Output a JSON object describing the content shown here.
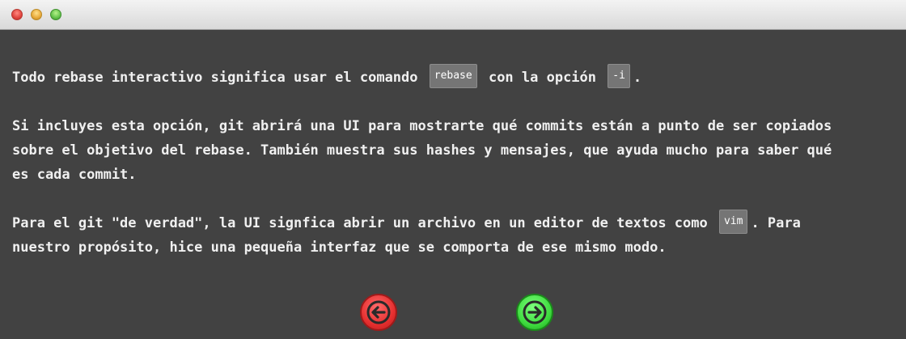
{
  "paragraphs": {
    "p1": {
      "before": "Todo rebase interactivo significa usar el comando ",
      "code1": "rebase",
      "middle": " con la opción ",
      "code2": "-i",
      "after": "."
    },
    "p2": {
      "line1": "Si incluyes esta opción, git abrirá una UI para mostrarte qué commits están a punto de ser copiados",
      "line2": "sobre el objetivo del rebase. También muestra sus hashes y mensajes, que ayuda mucho para saber qué",
      "line3": "es cada commit."
    },
    "p3": {
      "line1_before": "Para el git \"de verdad\", la UI signfica abrir un archivo en un editor de textos como ",
      "code": "vim",
      "line1_after": ". Para",
      "line2": "nuestro propósito, hice una pequeña interfaz que se comporta de ese mismo modo."
    }
  },
  "icons": {
    "prev": "arrow-left-icon",
    "next": "arrow-right-icon",
    "close": "close-window-icon",
    "minimize": "minimize-window-icon",
    "maximize": "maximize-window-icon"
  },
  "colors": {
    "background": "#424242",
    "text": "#f0f0f0",
    "code_background": "#757575",
    "prev_button": "#e52f2f",
    "next_button": "#3fdc3f"
  }
}
